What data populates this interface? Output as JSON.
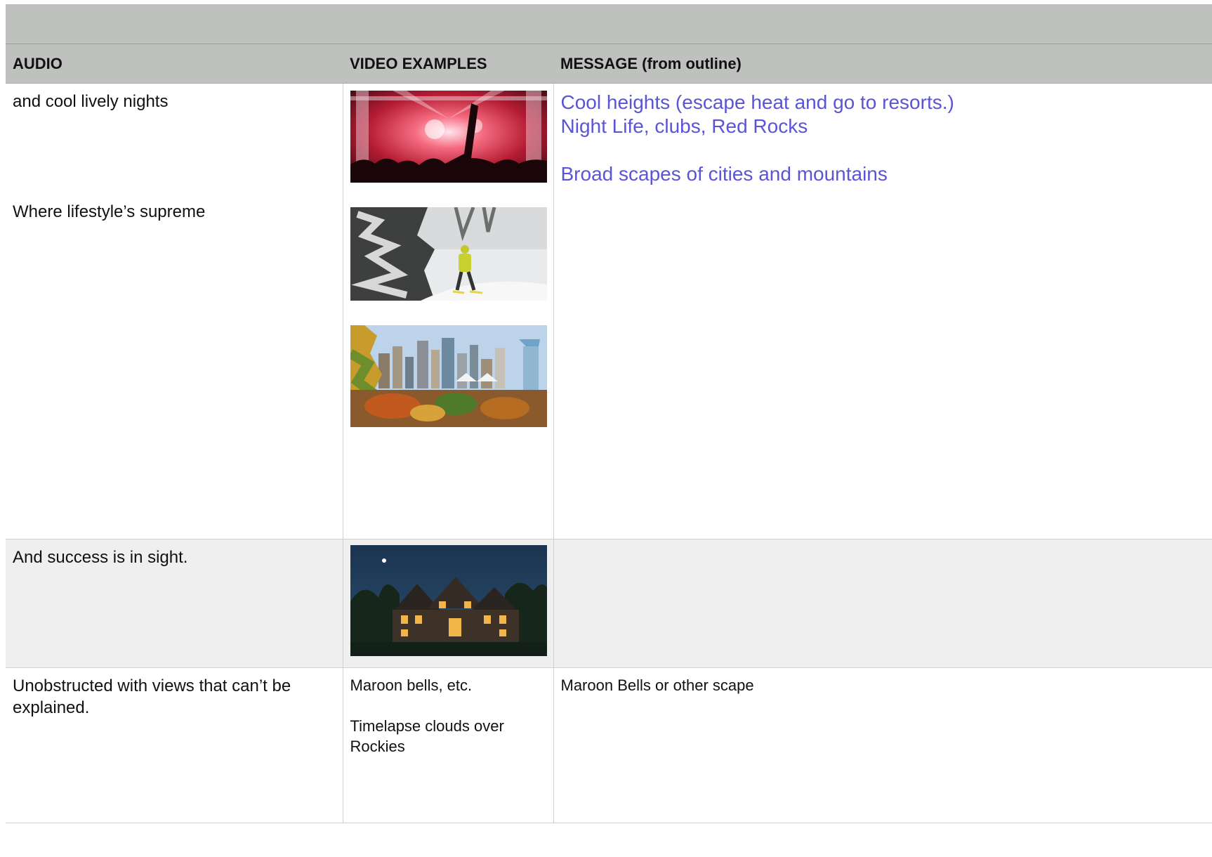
{
  "table": {
    "headers": {
      "audio": "AUDIO",
      "video": "VIDEO EXAMPLES",
      "message": "MESSAGE (from outline)"
    },
    "rows": [
      {
        "audio_lines": [
          "and cool lively nights",
          "Where lifestyle’s supreme"
        ],
        "video_images": [
          "concert-crowd-image",
          "skier-in-snow-image",
          "city-skyline-image"
        ],
        "message_lines": [
          "Cool heights (escape heat and go to resorts.)",
          "Night Life, clubs, Red Rocks",
          "Broad scapes of cities and mountains"
        ]
      },
      {
        "audio_lines": [
          "And success is in sight."
        ],
        "video_images": [
          "mansion-at-night-image"
        ],
        "message_lines": []
      },
      {
        "audio_lines": [
          "Unobstructed with views that can’t be explained."
        ],
        "video_lines": [
          "Maroon bells, etc.",
          "Timelapse clouds over Rockies"
        ],
        "message_lines": [
          "Maroon Bells or other scape"
        ]
      }
    ]
  },
  "colors": {
    "header_bg": "#bfc1bf",
    "message_link_blue": "#5a55d6",
    "alt_row_bg": "#efefef"
  }
}
